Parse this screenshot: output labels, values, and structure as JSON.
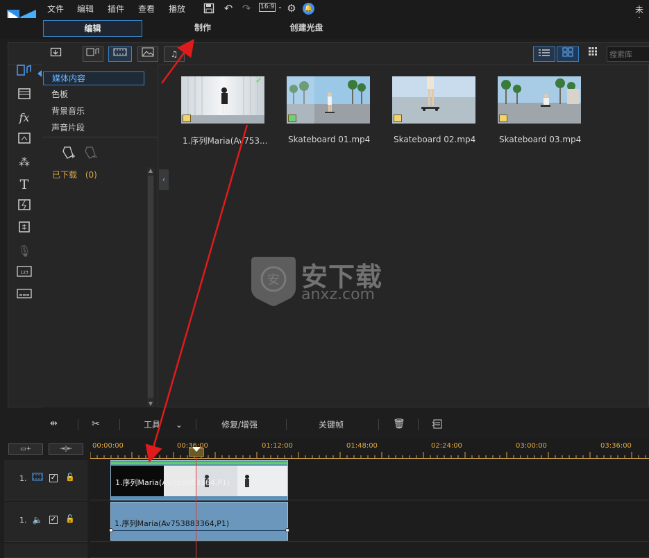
{
  "menu": {
    "items": [
      "文件",
      "编辑",
      "插件",
      "查看",
      "播放"
    ],
    "aspect_ratio": "16:9",
    "title_right": "未命"
  },
  "mode_tabs": [
    "编辑",
    "制作",
    "创建光盘"
  ],
  "library": {
    "search_placeholder": "搜索库",
    "categories": [
      "媒体内容",
      "色板",
      "背景音乐",
      "声音片段"
    ],
    "downloaded_label": "已下载",
    "downloaded_count": "(0)",
    "media": [
      {
        "label": "1.序列Maria(Av753...",
        "type": "video",
        "checked": true
      },
      {
        "label": "Skateboard 01.mp4",
        "type": "video",
        "checked": false
      },
      {
        "label": "Skateboard 02.mp4",
        "type": "video",
        "checked": false
      },
      {
        "label": "Skateboard 03.mp4",
        "type": "video",
        "checked": false
      }
    ]
  },
  "watermark": {
    "main": "安下载",
    "sub": "anxz.com"
  },
  "timeline_toolbar": {
    "tools": "工具",
    "repair": "修复/增强",
    "keyframe": "关键帧"
  },
  "timeline": {
    "ruler_labels": [
      "00:00:00",
      "00:36:00",
      "01:12:00",
      "01:48:00",
      "02:24:00",
      "03:00:00",
      "03:36:00"
    ],
    "tracks": [
      {
        "number": "1.",
        "kind": "video"
      },
      {
        "number": "1.",
        "kind": "audio"
      }
    ],
    "video_clip_label": "1.序列Maria(Av753883364,P1)",
    "audio_clip_label": "1.序列Maria(Av753883364,P1)"
  },
  "colors": {
    "accent": "#3b82c8",
    "timecode": "#e0a845",
    "playhead": "#e03a3a",
    "annotation_arrow": "#e01b1b"
  }
}
